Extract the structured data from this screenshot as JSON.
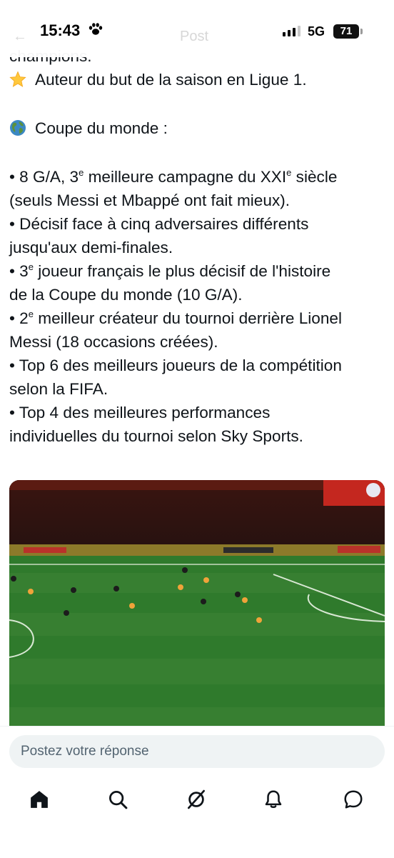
{
  "status": {
    "time": "15:43",
    "network": "5G",
    "battery": "71"
  },
  "header": {
    "back_label": "←",
    "title": "Post"
  },
  "post": {
    "partial_first": "champions.",
    "line_award": "Auteur du but de la saison en Ligue 1.",
    "section_title": "Coupe du monde :",
    "b1_a": "• 8 G/A, 3",
    "b1_sup1": "e",
    "b1_b": " meilleure campagne du XXI",
    "b1_sup2": "e",
    "b1_c": " siècle",
    "b1_line2": "(seuls Messi et Mbappé ont fait mieux).",
    "b2_line1": "• Décisif face à cinq adversaires différents",
    "b2_line2": "jusqu'aux demi-finales.",
    "b3_a": "• 3",
    "b3_sup": "e",
    "b3_b": " joueur français le plus décisif de l'histoire",
    "b3_line2": "de la Coupe du monde (10 G/A).",
    "b4_a": "• 2",
    "b4_sup": "e",
    "b4_b": " meilleur créateur du tournoi derrière Lionel",
    "b4_line2": "Messi (18 occasions créées).",
    "b5_line1": "• Top 6 des meilleurs joueurs de la compétition",
    "b5_line2": "selon la FIFA.",
    "b6_line1": "• Top 4 des meilleures performances",
    "b6_line2": "individuelles du tournoi selon Sky Sports."
  },
  "reply": {
    "placeholder": "Postez votre réponse"
  },
  "nav": {
    "icons": [
      "home-icon",
      "search-icon",
      "grok-icon",
      "notifications-icon",
      "messages-icon"
    ]
  },
  "colors": {
    "text": "#0f1419",
    "muted": "#536471",
    "input_bg": "#eff3f4",
    "pitch": "#2f7a2c"
  }
}
